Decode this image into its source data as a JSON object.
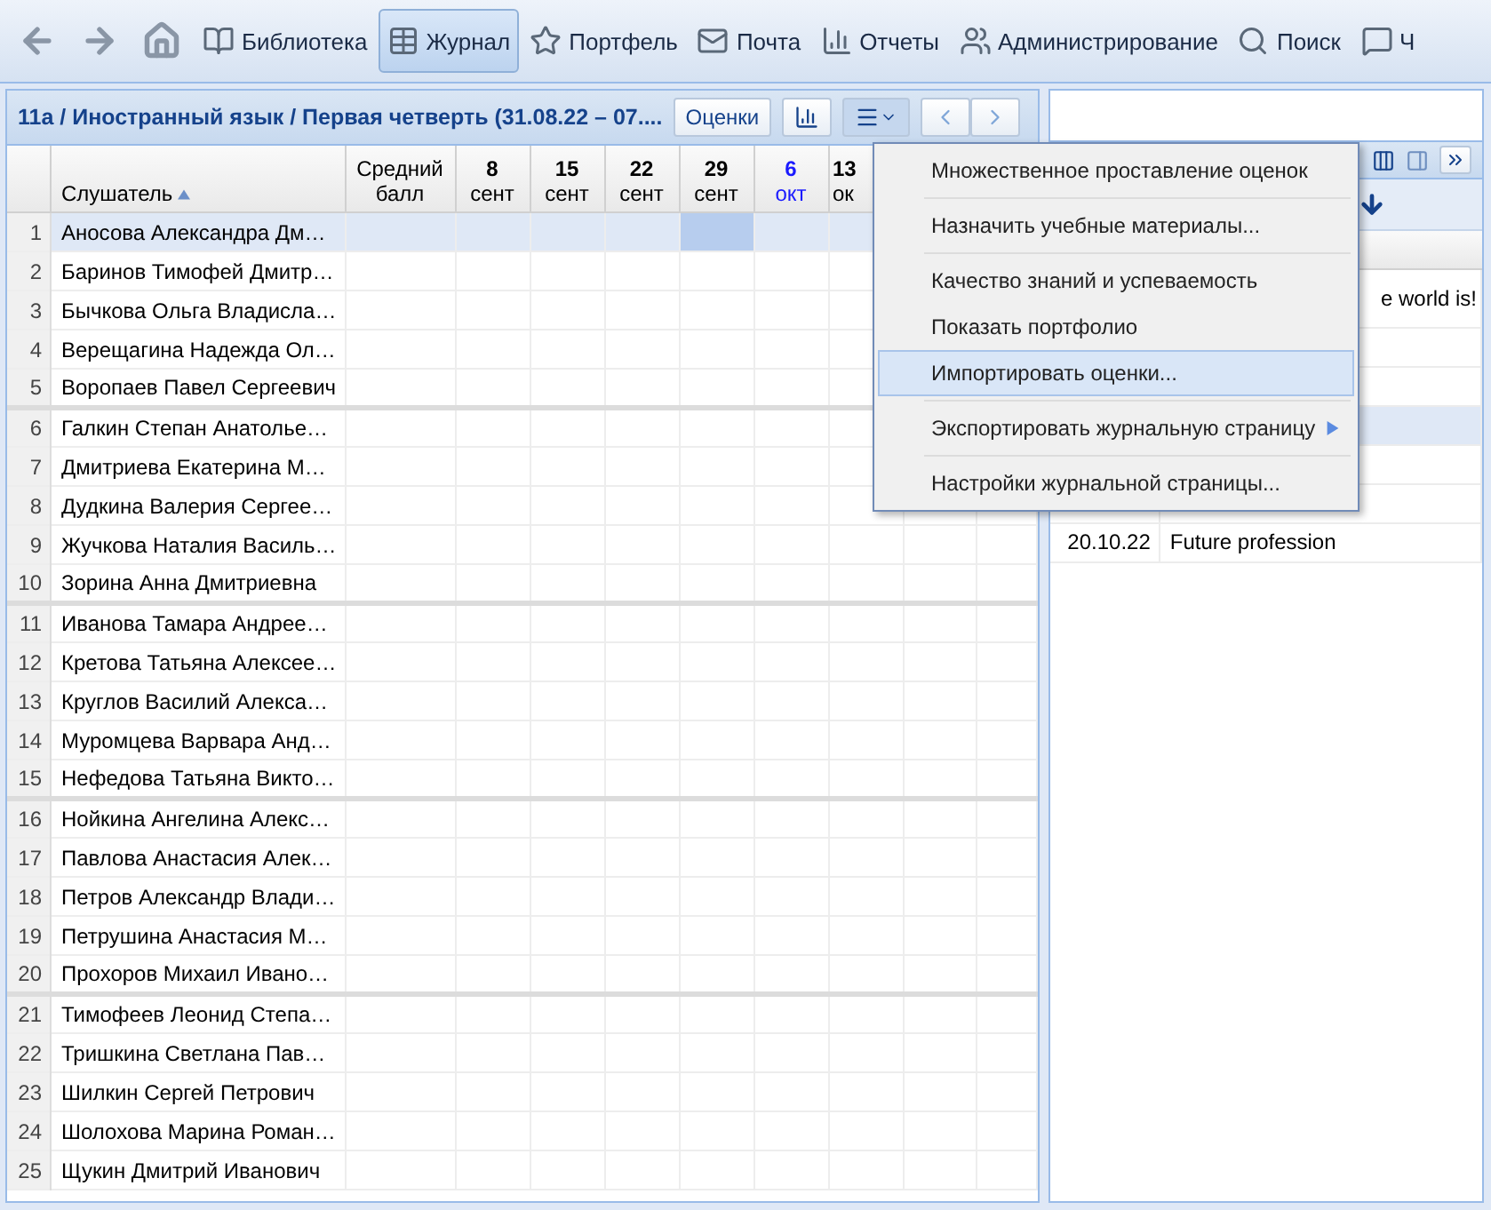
{
  "toolbar": {
    "nav": [
      {
        "kind": "back"
      },
      {
        "kind": "forward"
      },
      {
        "kind": "home"
      }
    ],
    "items": [
      {
        "label": "Библиотека",
        "selected": false
      },
      {
        "label": "Журнал",
        "selected": true
      },
      {
        "label": "Портфель",
        "selected": false
      },
      {
        "label": "Почта",
        "selected": false
      },
      {
        "label": "Отчеты",
        "selected": false
      },
      {
        "label": "Администрирование",
        "selected": false
      },
      {
        "label": "Поиск",
        "selected": false
      },
      {
        "label": "Ч",
        "selected": false
      }
    ]
  },
  "journal": {
    "title": "11а / Иностранный язык / Первая четверть (31.08.22 – 07....",
    "grades_button": "Оценки",
    "columns": {
      "student": "Слушатель",
      "average": "Средний балл",
      "dates": [
        {
          "day": "8",
          "month": "сент",
          "current": false
        },
        {
          "day": "15",
          "month": "сент",
          "current": false
        },
        {
          "day": "22",
          "month": "сент",
          "current": false
        },
        {
          "day": "29",
          "month": "сент",
          "current": false
        },
        {
          "day": "6",
          "month": "окт",
          "current": true
        },
        {
          "day": "13",
          "month": "ок",
          "current": false
        }
      ]
    },
    "rows": [
      {
        "n": "1",
        "name": "Аносова Александра Дм…",
        "selected": true
      },
      {
        "n": "2",
        "name": "Баринов Тимофей Дмитр…",
        "selected": false
      },
      {
        "n": "3",
        "name": "Бычкова Ольга Владисла…",
        "selected": false
      },
      {
        "n": "4",
        "name": "Верещагина Надежда Ол…",
        "selected": false
      },
      {
        "n": "5",
        "name": "Воропаев Павел Сергеевич",
        "selected": false
      },
      {
        "n": "6",
        "name": "Галкин Степан Анатолье…",
        "selected": false
      },
      {
        "n": "7",
        "name": "Дмитриева Екатерина М…",
        "selected": false
      },
      {
        "n": "8",
        "name": "Дудкина Валерия Сергее…",
        "selected": false
      },
      {
        "n": "9",
        "name": "Жучкова Наталия Василь…",
        "selected": false
      },
      {
        "n": "10",
        "name": "Зорина Анна Дмитриевна",
        "selected": false
      },
      {
        "n": "11",
        "name": "Иванова Тамара Андрее…",
        "selected": false
      },
      {
        "n": "12",
        "name": "Кретова Татьяна Алексее…",
        "selected": false
      },
      {
        "n": "13",
        "name": "Круглов Василий Алекса…",
        "selected": false
      },
      {
        "n": "14",
        "name": "Муромцева Варвара Анд…",
        "selected": false
      },
      {
        "n": "15",
        "name": "Нефедова Татьяна Викто…",
        "selected": false
      },
      {
        "n": "16",
        "name": "Нойкина Ангелина Алекс…",
        "selected": false
      },
      {
        "n": "17",
        "name": "Павлова Анастасия Алек…",
        "selected": false
      },
      {
        "n": "18",
        "name": "Петров Александр Влади…",
        "selected": false
      },
      {
        "n": "19",
        "name": "Петрушина Анастасия М…",
        "selected": false
      },
      {
        "n": "20",
        "name": "Прохоров Михаил Ивано…",
        "selected": false
      },
      {
        "n": "21",
        "name": "Тимофеев Леонид Степа…",
        "selected": false
      },
      {
        "n": "22",
        "name": "Тришкина Светлана Пав…",
        "selected": false
      },
      {
        "n": "23",
        "name": "Шилкин Сергей Петрович",
        "selected": false
      },
      {
        "n": "24",
        "name": "Шолохова Марина Роман…",
        "selected": false
      },
      {
        "n": "25",
        "name": "Щукин Дмитрий Иванович",
        "selected": false
      }
    ]
  },
  "lessons": {
    "rows": [
      {
        "date": "",
        "topic": "e world is!",
        "selected": false
      },
      {
        "date": "",
        "topic": "",
        "selected": false
      },
      {
        "date": "",
        "topic": "",
        "selected": false
      },
      {
        "date": "",
        "topic": "",
        "selected": true
      },
      {
        "date": "",
        "topic": "",
        "selected": false
      },
      {
        "date": "",
        "topic": "",
        "selected": false
      },
      {
        "date": "20.10.22",
        "topic": "Future profession",
        "selected": false
      }
    ]
  },
  "menu": [
    {
      "kind": "item",
      "label": "Множественное проставление оценок",
      "selected": false
    },
    {
      "kind": "separator"
    },
    {
      "kind": "item",
      "label": "Назначить учебные материалы...",
      "selected": false
    },
    {
      "kind": "separator"
    },
    {
      "kind": "item",
      "label": "Качество знаний и успеваемость",
      "selected": false
    },
    {
      "kind": "item",
      "label": "Показать портфолио",
      "selected": false
    },
    {
      "kind": "item",
      "label": "Импортировать оценки...",
      "selected": true
    },
    {
      "kind": "separator"
    },
    {
      "kind": "submenu",
      "label": "Экспортировать журнальную страницу",
      "selected": false
    },
    {
      "kind": "separator"
    },
    {
      "kind": "item",
      "label": "Настройки журнальной страницы...",
      "selected": false
    }
  ]
}
